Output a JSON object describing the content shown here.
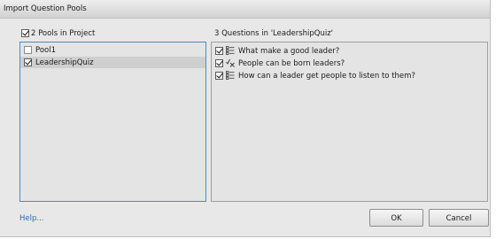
{
  "window": {
    "title": "Import Question Pools"
  },
  "pools_header": {
    "label": "2 Pools in Project",
    "checked": true
  },
  "questions_header": {
    "label": "3 Questions in  'LeadershipQuiz'"
  },
  "pools": [
    {
      "label": "Pool1",
      "checked": false,
      "selected": false
    },
    {
      "label": "LeadershipQuiz",
      "checked": true,
      "selected": true
    }
  ],
  "questions": [
    {
      "label": "What make a good leader?",
      "checked": true,
      "icon": "multiple-choice-icon"
    },
    {
      "label": "People can be born leaders?",
      "checked": true,
      "icon": "true-false-icon"
    },
    {
      "label": "How can a leader get people to listen to them?",
      "checked": true,
      "icon": "multiple-choice-icon"
    }
  ],
  "footer": {
    "help_label": "Help...",
    "ok_label": "OK",
    "cancel_label": "Cancel"
  }
}
